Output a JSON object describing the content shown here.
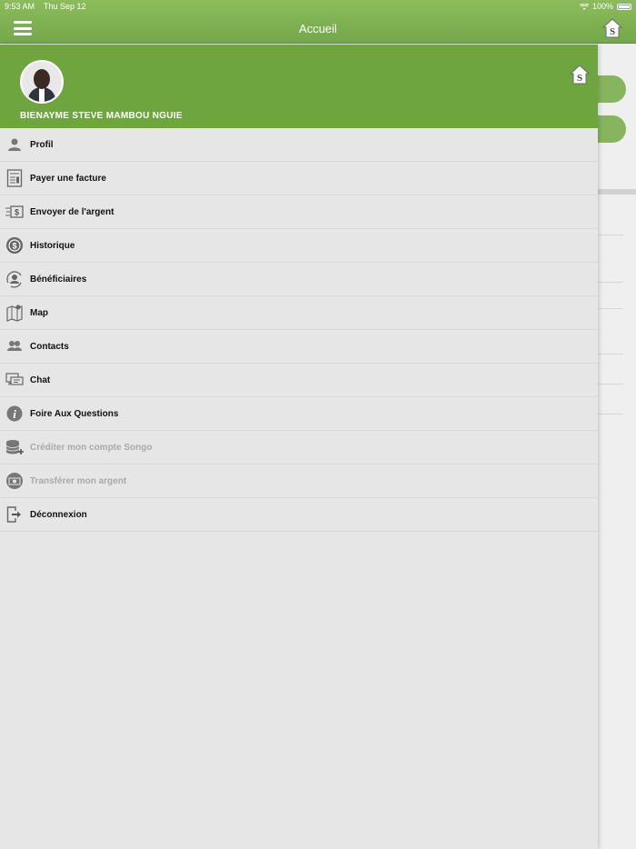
{
  "status_bar": {
    "time": "9:53 AM",
    "date": "Thu Sep 12",
    "battery": "100%"
  },
  "app_bar": {
    "title": "Accueil"
  },
  "drawer": {
    "user_name": "BIENAYME STEVE MAMBOU NGUIE",
    "menu": [
      {
        "label": "Profil",
        "icon": "person-icon",
        "enabled": true
      },
      {
        "label": "Payer une facture",
        "icon": "invoice-icon",
        "enabled": true
      },
      {
        "label": "Envoyer de l'argent",
        "icon": "send-money-icon",
        "enabled": true
      },
      {
        "label": "Historique",
        "icon": "history-icon",
        "enabled": true
      },
      {
        "label": "Bénéficiaires",
        "icon": "beneficiaries-icon",
        "enabled": true
      },
      {
        "label": "Map",
        "icon": "map-icon",
        "enabled": true
      },
      {
        "label": "Contacts",
        "icon": "contacts-icon",
        "enabled": true
      },
      {
        "label": "Chat",
        "icon": "chat-icon",
        "enabled": true
      },
      {
        "label": "Foire Aux Questions",
        "icon": "info-icon",
        "enabled": true
      },
      {
        "label": "Créditer mon compte Songo",
        "icon": "credit-account-icon",
        "enabled": false
      },
      {
        "label": "Transférer mon argent",
        "icon": "transfer-money-icon",
        "enabled": false
      },
      {
        "label": "Déconnexion",
        "icon": "logout-icon",
        "enabled": true
      }
    ]
  },
  "colors": {
    "primary_green": "#6fa53f",
    "appbar_green": "#7cb04e",
    "drawer_bg": "#e6e6e6",
    "disabled_text": "#a9a9a9"
  }
}
